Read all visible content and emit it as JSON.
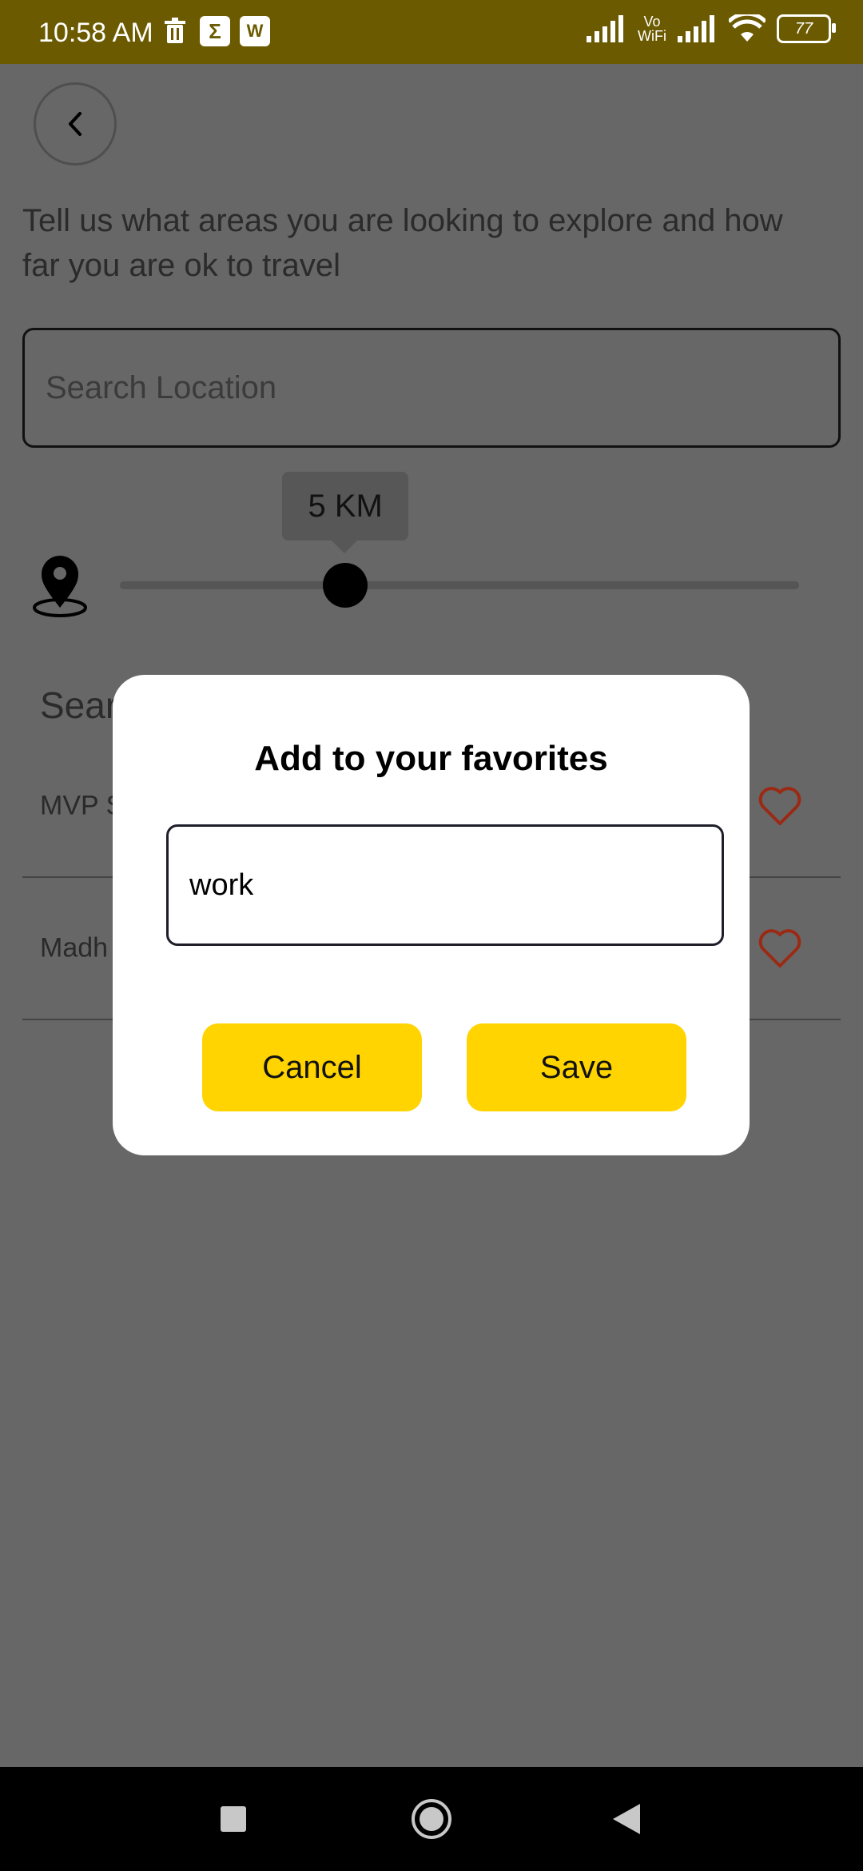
{
  "status_bar": {
    "time": "10:58 AM",
    "left_icons": [
      "trash-icon",
      "sigma-icon",
      "wps-icon"
    ],
    "vowifi_top": "Vo",
    "vowifi_bottom": "WiFi",
    "battery": "77"
  },
  "page": {
    "intro_text": "Tell us what areas you are looking to explore and how far you are ok to travel",
    "search_placeholder": "Search Location",
    "distance_label": "5 KM",
    "distance_value_fraction": 0.4,
    "section_title": "Sear",
    "results": [
      {
        "label": "MVP S"
      },
      {
        "label": "Madh"
      }
    ]
  },
  "dialog": {
    "title": "Add to your favorites",
    "input_value": "work",
    "cancel_label": "Cancel",
    "save_label": "Save"
  },
  "colors": {
    "status_bar": "#6b5a00",
    "accent_yellow": "#ffd400",
    "heart": "#9b2a14"
  },
  "nav_bar": {
    "buttons": [
      "recents-square-icon",
      "home-circle-icon",
      "back-triangle-icon"
    ]
  }
}
